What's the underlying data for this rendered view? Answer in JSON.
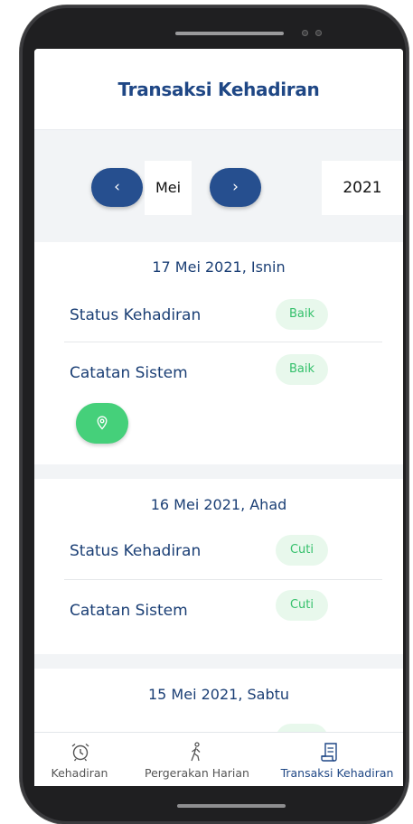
{
  "header": {
    "title": "Transaksi Kehadiran"
  },
  "month_nav": {
    "prev_icon": "chevron-left-icon",
    "next_icon": "chevron-right-icon",
    "prev_glyph": "‹",
    "next_glyph": "›",
    "month": "Mei",
    "year": "2021"
  },
  "days": [
    {
      "date": "17 Mei 2021, Isnin",
      "rows": [
        {
          "label": "Status Kehadiran",
          "badge": "Baik"
        },
        {
          "label": "Catatan Sistem",
          "badge": "Baik"
        }
      ],
      "location_icon": "map-pin-icon"
    },
    {
      "date": "16 Mei 2021, Ahad",
      "rows": [
        {
          "label": "Status Kehadiran",
          "badge": "Cuti"
        },
        {
          "label": "Catatan Sistem",
          "badge": "Cuti"
        }
      ]
    },
    {
      "date": "15 Mei 2021, Sabtu"
    }
  ],
  "tabs": [
    {
      "label": "Kehadiran",
      "icon": "alarm-clock-icon",
      "active": false
    },
    {
      "label": "Pergerakan Harian",
      "icon": "walking-person-icon",
      "active": false
    },
    {
      "label": "Transaksi Kehadiran",
      "icon": "receipt-icon",
      "active": true
    }
  ],
  "colors": {
    "primary": "#1f4785",
    "badge_text": "#34c06b",
    "badge_bg": "#e8f8ec",
    "location_button": "#45d07a",
    "nav_button": "#264f8f"
  }
}
